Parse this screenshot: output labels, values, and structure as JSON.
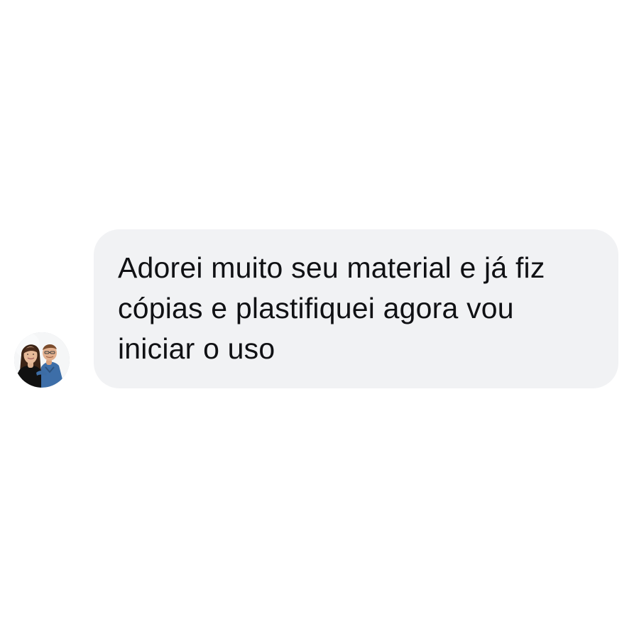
{
  "conversation": {
    "message": {
      "text": "Adorei muito seu material e já fiz cópias e plastifiquei agora vou iniciar o uso",
      "bubble_color": "#f1f2f4",
      "text_color": "#101114"
    },
    "avatar": {
      "icon": "avatar-photo"
    }
  },
  "page": {
    "background": "#ffffff"
  }
}
